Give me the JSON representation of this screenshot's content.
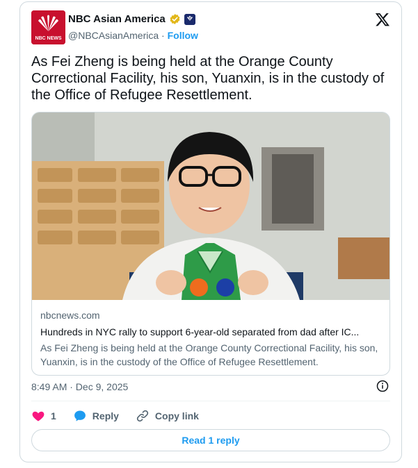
{
  "author": {
    "name": "NBC Asian America",
    "handle": "@NBCAsianAmerica",
    "separator": "·",
    "follow_label": "Follow",
    "avatar_text": "NBC NEWS"
  },
  "tweet": {
    "text": "As Fei Zheng is being held at the Orange County Correctional Facility, his son, Yuanxin, is in the custody of the Office of Refugee Resettlement."
  },
  "link_card": {
    "domain": "nbcnews.com",
    "title": "Hundreds in NYC rally to support 6-year-old separated from dad after IC...",
    "description": "As Fei Zheng is being held at the Orange County Correctional Facility, his son, Yuanxin, is in the custody of the Office of Refugee Resettlement."
  },
  "meta": {
    "timestamp": "8:49 AM · Dec 9, 2025"
  },
  "actions": {
    "like_count": "1",
    "reply_label": "Reply",
    "copy_link_label": "Copy link"
  },
  "read_replies_label": "Read 1 reply",
  "colors": {
    "accent": "#1d9bf0",
    "like": "#f91880",
    "brand_red": "#c8102e"
  },
  "icons": [
    "nbc-peacock-icon",
    "verified-badge-icon",
    "affiliate-badge-icon",
    "x-logo-icon",
    "info-icon",
    "heart-icon",
    "reply-bubble-icon",
    "link-icon"
  ]
}
